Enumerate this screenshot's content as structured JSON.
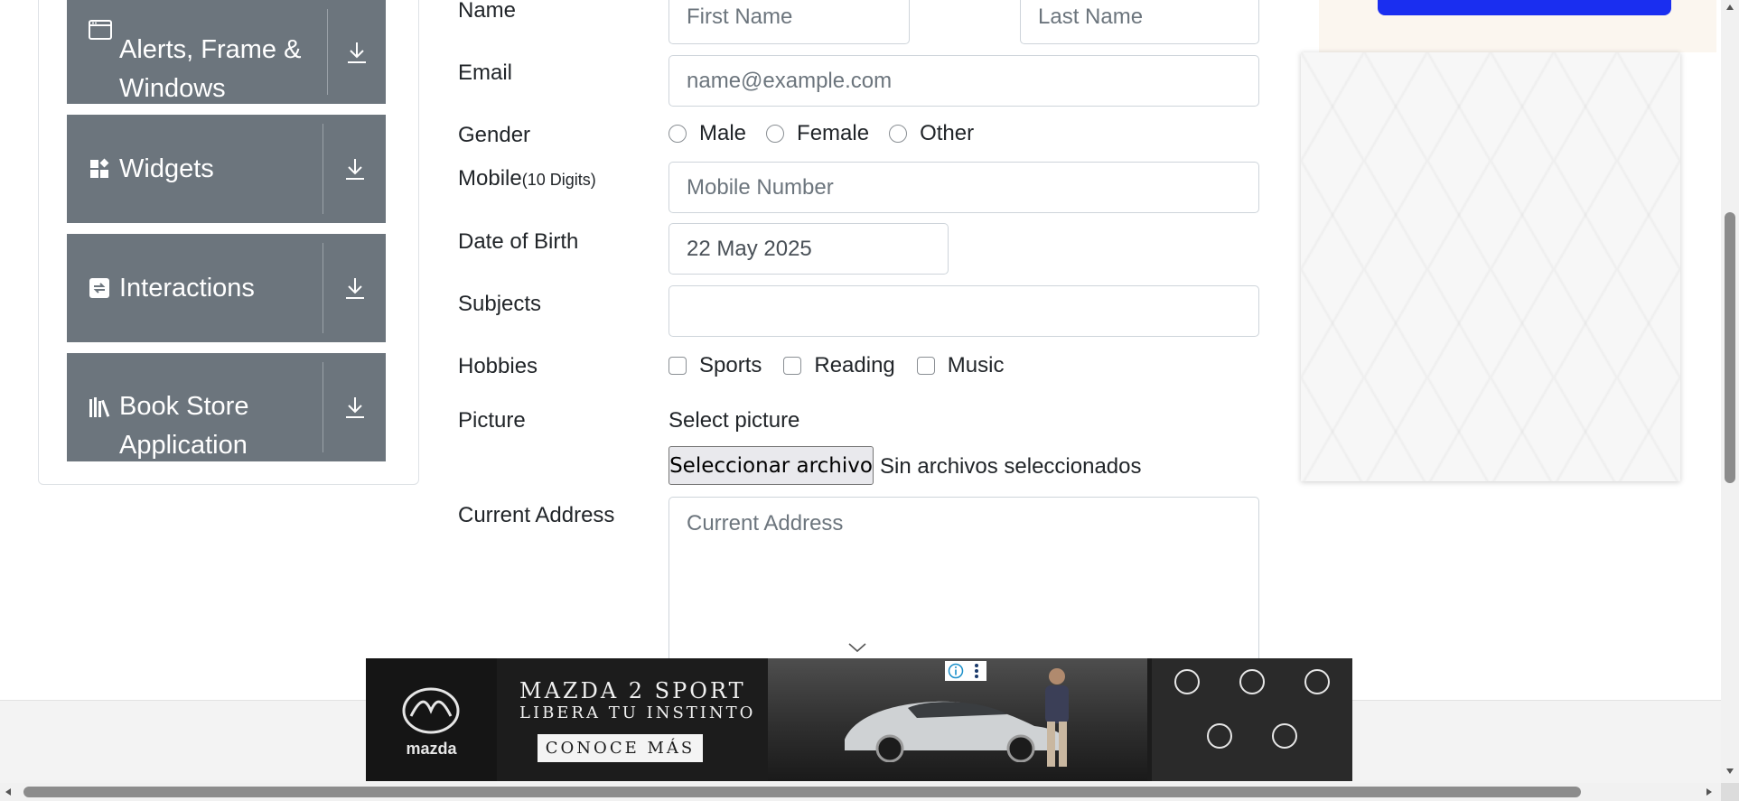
{
  "sidebar": {
    "groups": [
      {
        "label": "Alerts, Frame & Windows",
        "icon": "window-icon"
      },
      {
        "label": "Widgets",
        "icon": "widgets-icon"
      },
      {
        "label": "Interactions",
        "icon": "interactions-icon"
      },
      {
        "label": "Book Store Application",
        "icon": "books-icon"
      }
    ]
  },
  "form": {
    "name_label": "Name",
    "first_name_placeholder": "First Name",
    "last_name_placeholder": "Last Name",
    "email_label": "Email",
    "email_placeholder": "name@example.com",
    "gender_label": "Gender",
    "gender_options": [
      "Male",
      "Female",
      "Other"
    ],
    "mobile_label": "Mobile",
    "mobile_hint": "(10 Digits)",
    "mobile_placeholder": "Mobile Number",
    "dob_label": "Date of Birth",
    "dob_value": "22 May 2025",
    "subjects_label": "Subjects",
    "subjects_value": "",
    "hobbies_label": "Hobbies",
    "hobby_options": [
      "Sports",
      "Reading",
      "Music"
    ],
    "picture_label": "Picture",
    "picture_prompt": "Select picture",
    "file_button": "Seleccionar archivo",
    "file_status": "Sin archivos seleccionados",
    "address_label": "Current Address",
    "address_placeholder": "Current Address"
  },
  "ad": {
    "brand": "mazda",
    "title": "MAZDA 2 SPORT",
    "subtitle": "LIBERA TU INSTINTO",
    "cta": "CONOCE MÁS"
  },
  "colors": {
    "sidebar_bg": "#6c757d",
    "ad_button_blue": "#1a2ef0"
  }
}
